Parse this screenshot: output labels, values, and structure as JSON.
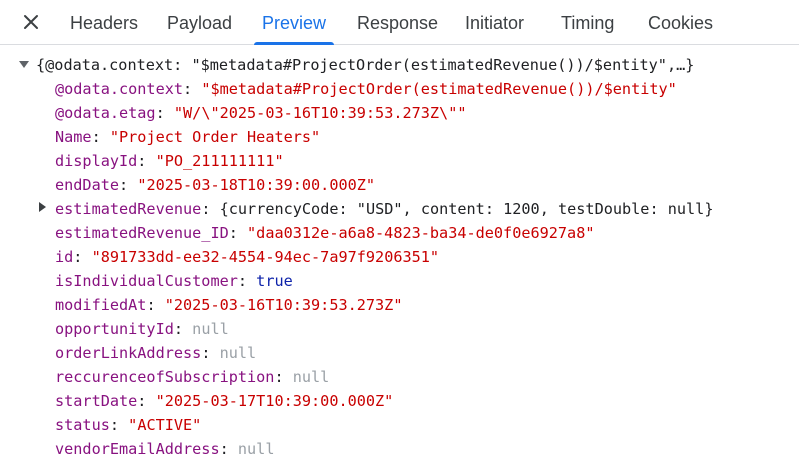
{
  "tabs": [
    {
      "label": "Headers"
    },
    {
      "label": "Payload"
    },
    {
      "label": "Preview",
      "active": true
    },
    {
      "label": "Response"
    },
    {
      "label": "Initiator"
    },
    {
      "label": "Timing"
    },
    {
      "label": "Cookies"
    }
  ],
  "icons": {
    "close": "close-icon",
    "expand_root": "triangle-down-icon",
    "expand_child": "triangle-right-icon"
  },
  "colors": {
    "accent": "#1a73e8",
    "key": "#881280",
    "string": "#c80000",
    "number": "#1a1aa6",
    "boolean": "#0d22aa",
    "null": "#9aa0a6"
  },
  "preview": {
    "root": {
      "open_brace": "{",
      "summary_key": "@odata.context",
      "summary_sep": ": ",
      "summary_value": "\"$metadata#ProjectOrder(estimatedRevenue())/$entity\"",
      "summary_tail": ",…}"
    },
    "sep": ": ",
    "properties": [
      {
        "key": "@odata.context",
        "value": "\"$metadata#ProjectOrder(estimatedRevenue())/$entity\"",
        "type": "string"
      },
      {
        "key": "@odata.etag",
        "value": "\"W/\\\"2025-03-16T10:39:53.273Z\\\"\"",
        "type": "string"
      },
      {
        "key": "Name",
        "value": "\"Project Order Heaters\"",
        "type": "string"
      },
      {
        "key": "displayId",
        "value": "\"PO_211111111\"",
        "type": "string"
      },
      {
        "key": "endDate",
        "value": "\"2025-03-18T10:39:00.000Z\"",
        "type": "string"
      },
      {
        "key": "estimatedRevenue",
        "type": "object",
        "preview": {
          "open": "{",
          "k1": "currencyCode",
          "v1": "\"USD\"",
          "k2": "content",
          "v2": "1200",
          "k3": "testDouble",
          "v3": "null",
          "comma": ", ",
          "close": "}"
        }
      },
      {
        "key": "estimatedRevenue_ID",
        "value": "\"daa0312e-a6a8-4823-ba34-de0f0e6927a8\"",
        "type": "string"
      },
      {
        "key": "id",
        "value": "\"891733dd-ee32-4554-94ec-7a97f9206351\"",
        "type": "string"
      },
      {
        "key": "isIndividualCustomer",
        "value": "true",
        "type": "bool"
      },
      {
        "key": "modifiedAt",
        "value": "\"2025-03-16T10:39:53.273Z\"",
        "type": "string"
      },
      {
        "key": "opportunityId",
        "value": "null",
        "type": "null"
      },
      {
        "key": "orderLinkAddress",
        "value": "null",
        "type": "null"
      },
      {
        "key": "reccurenceofSubscription",
        "value": "null",
        "type": "null"
      },
      {
        "key": "startDate",
        "value": "\"2025-03-17T10:39:00.000Z\"",
        "type": "string"
      },
      {
        "key": "status",
        "value": "\"ACTIVE\"",
        "type": "string"
      },
      {
        "key": "vendorEmailAddress",
        "value": "null",
        "type": "null"
      }
    ]
  }
}
